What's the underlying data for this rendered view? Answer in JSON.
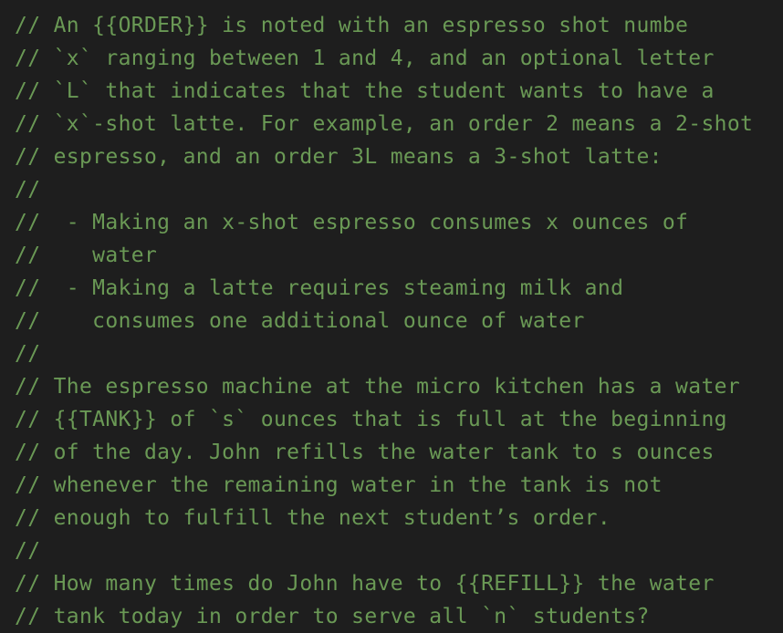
{
  "editor": {
    "comment_color": "#6a9955",
    "background_color": "#1e1e1e",
    "lines": [
      "// An {{ORDER}} is noted with an espresso shot numbe",
      "// `x` ranging between 1 and 4, and an optional letter",
      "// `L` that indicates that the student wants to have a",
      "// `x`-shot latte. For example, an order 2 means a 2-shot",
      "// espresso, and an order 3L means a 3-shot latte:",
      "//",
      "//  - Making an x-shot espresso consumes x ounces of",
      "//    water",
      "//  - Making a latte requires steaming milk and",
      "//    consumes one additional ounce of water",
      "//",
      "// The espresso machine at the micro kitchen has a water",
      "// {{TANK}} of `s` ounces that is full at the beginning",
      "// of the day. John refills the water tank to s ounces",
      "// whenever the remaining water in the tank is not",
      "// enough to fulfill the next student’s order.",
      "//",
      "// How many times do John have to {{REFILL}} the water",
      "// tank today in order to serve all `n` students?"
    ]
  }
}
